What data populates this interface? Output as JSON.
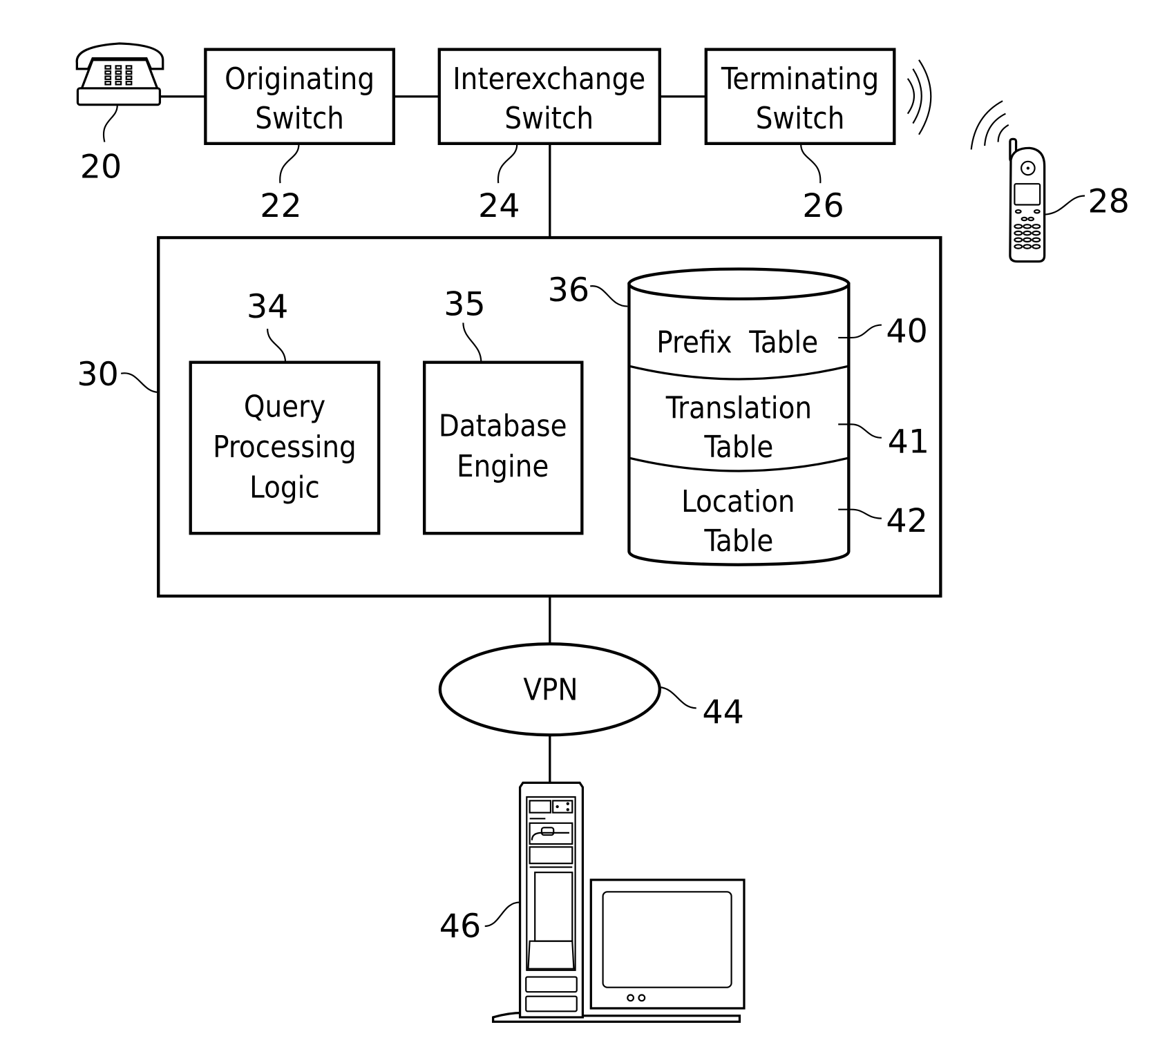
{
  "figure": {
    "nodes": {
      "telephone": {
        "ref": "20",
        "icon": "telephone-icon"
      },
      "originating_switch": {
        "lines": [
          "Originating",
          "Switch"
        ],
        "ref": "22"
      },
      "interexchange_switch": {
        "lines": [
          "Interexchange",
          "Switch"
        ],
        "ref": "24"
      },
      "terminating_switch": {
        "lines": [
          "Terminating",
          "Switch"
        ],
        "ref": "26"
      },
      "mobile_phone": {
        "ref": "28",
        "icon": "mobile-phone-icon"
      },
      "service_node": {
        "ref": "30"
      },
      "query_processing_logic": {
        "lines": [
          "Query",
          "Processing",
          "Logic"
        ],
        "ref": "34"
      },
      "database_engine": {
        "lines": [
          "Database",
          "Engine"
        ],
        "ref": "35"
      },
      "database": {
        "ref": "36",
        "tables": [
          {
            "lines": [
              "Prefix  Table"
            ],
            "ref": "40"
          },
          {
            "lines": [
              "Translation",
              "Table"
            ],
            "ref": "41"
          },
          {
            "lines": [
              "Location",
              "Table"
            ],
            "ref": "42"
          }
        ]
      },
      "vpn": {
        "label": "VPN",
        "ref": "44"
      },
      "computer": {
        "ref": "46",
        "icon": "computer-workstation-icon"
      }
    },
    "connections": [
      [
        "telephone",
        "originating_switch"
      ],
      [
        "originating_switch",
        "interexchange_switch"
      ],
      [
        "interexchange_switch",
        "terminating_switch"
      ],
      [
        "terminating_switch",
        "mobile_phone",
        "wireless"
      ],
      [
        "interexchange_switch",
        "service_node"
      ],
      [
        "service_node",
        "vpn"
      ],
      [
        "vpn",
        "computer"
      ]
    ],
    "colors": {
      "ink": "#000000",
      "background": "#ffffff"
    }
  }
}
